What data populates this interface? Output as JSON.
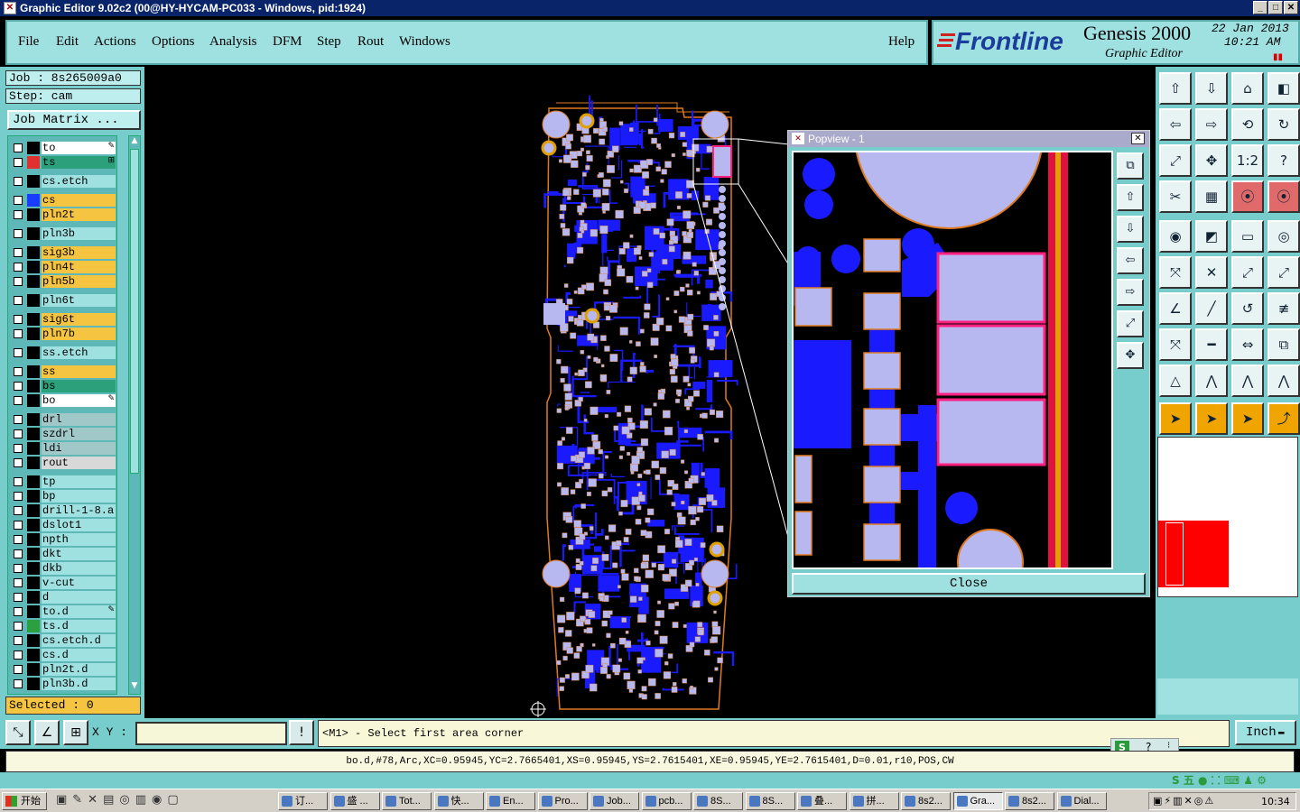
{
  "window": {
    "title": "Graphic Editor 9.02c2 (00@HY-HYCAM-PC033 - Windows, pid:1924)"
  },
  "menu": [
    "File",
    "Edit",
    "Actions",
    "Options",
    "Analysis",
    "DFM",
    "Step",
    "Rout",
    "Windows"
  ],
  "help_label": "Help",
  "brand": {
    "logo": "Frontline",
    "product": "Genesis 2000",
    "subtitle": "Graphic Editor",
    "date": "22 Jan 2013",
    "time": "10:21 AM"
  },
  "job": {
    "job_line": "Job : 8s265009a0",
    "step_line": "Step: cam",
    "matrix_button": "Job Matrix ..."
  },
  "layers": [
    {
      "name": "to",
      "color": "#ffffff",
      "swatch": "#000000",
      "mark": "✎"
    },
    {
      "name": "ts",
      "color": "#2ca07a",
      "swatch": "#e03030",
      "mark": "⊞"
    },
    {
      "name": "cs.etch",
      "color": "#9fe0e0",
      "swatch": "#000000",
      "mark": ""
    },
    {
      "name": "cs",
      "color": "#f5c542",
      "swatch": "#1a3cff",
      "mark": ""
    },
    {
      "name": "pln2t",
      "color": "#f5c542",
      "swatch": "#000000",
      "mark": ""
    },
    {
      "name": "pln3b",
      "color": "#9fe0e0",
      "swatch": "#000000",
      "mark": ""
    },
    {
      "name": "sig3b",
      "color": "#f5c542",
      "swatch": "#000000",
      "mark": ""
    },
    {
      "name": "pln4t",
      "color": "#f5c542",
      "swatch": "#000000",
      "mark": ""
    },
    {
      "name": "pln5b",
      "color": "#f5c542",
      "swatch": "#000000",
      "mark": ""
    },
    {
      "name": "pln6t",
      "color": "#9fe0e0",
      "swatch": "#000000",
      "mark": ""
    },
    {
      "name": "sig6t",
      "color": "#f5c542",
      "swatch": "#000000",
      "mark": ""
    },
    {
      "name": "pln7b",
      "color": "#f5c542",
      "swatch": "#000000",
      "mark": ""
    },
    {
      "name": "ss.etch",
      "color": "#9fe0e0",
      "swatch": "#000000",
      "mark": ""
    },
    {
      "name": "ss",
      "color": "#f5c542",
      "swatch": "#000000",
      "mark": ""
    },
    {
      "name": "bs",
      "color": "#2ca07a",
      "swatch": "#000000",
      "mark": ""
    },
    {
      "name": "bo",
      "color": "#ffffff",
      "swatch": "#000000",
      "mark": "✎"
    },
    {
      "name": "drl",
      "color": "#a0c8c8",
      "swatch": "#000000",
      "mark": ""
    },
    {
      "name": "szdrl",
      "color": "#a0c8c8",
      "swatch": "#000000",
      "mark": ""
    },
    {
      "name": "ldi",
      "color": "#a0c8c8",
      "swatch": "#000000",
      "mark": ""
    },
    {
      "name": "rout",
      "color": "#d8d8d8",
      "swatch": "#000000",
      "mark": ""
    },
    {
      "name": "tp",
      "color": "#9fe0e0",
      "swatch": "#000000",
      "mark": ""
    },
    {
      "name": "bp",
      "color": "#9fe0e0",
      "swatch": "#000000",
      "mark": ""
    },
    {
      "name": "drill-1-8.a",
      "color": "#9fe0e0",
      "swatch": "#000000",
      "mark": ""
    },
    {
      "name": "dslot1",
      "color": "#9fe0e0",
      "swatch": "#000000",
      "mark": ""
    },
    {
      "name": "npth",
      "color": "#9fe0e0",
      "swatch": "#000000",
      "mark": ""
    },
    {
      "name": "dkt",
      "color": "#9fe0e0",
      "swatch": "#000000",
      "mark": ""
    },
    {
      "name": "dkb",
      "color": "#9fe0e0",
      "swatch": "#000000",
      "mark": ""
    },
    {
      "name": "v-cut",
      "color": "#9fe0e0",
      "swatch": "#000000",
      "mark": ""
    },
    {
      "name": "d",
      "color": "#9fe0e0",
      "swatch": "#000000",
      "mark": ""
    },
    {
      "name": "to.d",
      "color": "#9fe0e0",
      "swatch": "#000000",
      "mark": "✎"
    },
    {
      "name": "ts.d",
      "color": "#9fe0e0",
      "swatch": "#2ca040",
      "mark": ""
    },
    {
      "name": "cs.etch.d",
      "color": "#9fe0e0",
      "swatch": "#000000",
      "mark": ""
    },
    {
      "name": "cs.d",
      "color": "#9fe0e0",
      "swatch": "#000000",
      "mark": ""
    },
    {
      "name": "pln2t.d",
      "color": "#9fe0e0",
      "swatch": "#000000",
      "mark": ""
    },
    {
      "name": "pln3b.d",
      "color": "#9fe0e0",
      "swatch": "#000000",
      "mark": ""
    }
  ],
  "selected_label": "Selected : 0",
  "popview": {
    "title": "Popview - 1",
    "close_label": "Close"
  },
  "command": {
    "xy_label": "X Y :",
    "xy_value": "",
    "prompt": "<M1> - Select first area corner",
    "unit": "Inch"
  },
  "info_line": "bo.d,#78,Arc,XC=0.95945,YC=2.7665401,XS=0.95945,YS=2.7615401,XE=0.95945,YE=2.7615401,D=0.01,r10,POS,CW",
  "taskbar": {
    "start": "开始",
    "tasks": [
      "订...",
      "盛 ...",
      "Tot...",
      "快...",
      "En...",
      "Pro...",
      "Job...",
      "pcb...",
      "8S...",
      "8S...",
      "叠...",
      "拼...",
      "8s2...",
      "Gra...",
      "8s2...",
      "Dial..."
    ],
    "clock": "10:34"
  }
}
